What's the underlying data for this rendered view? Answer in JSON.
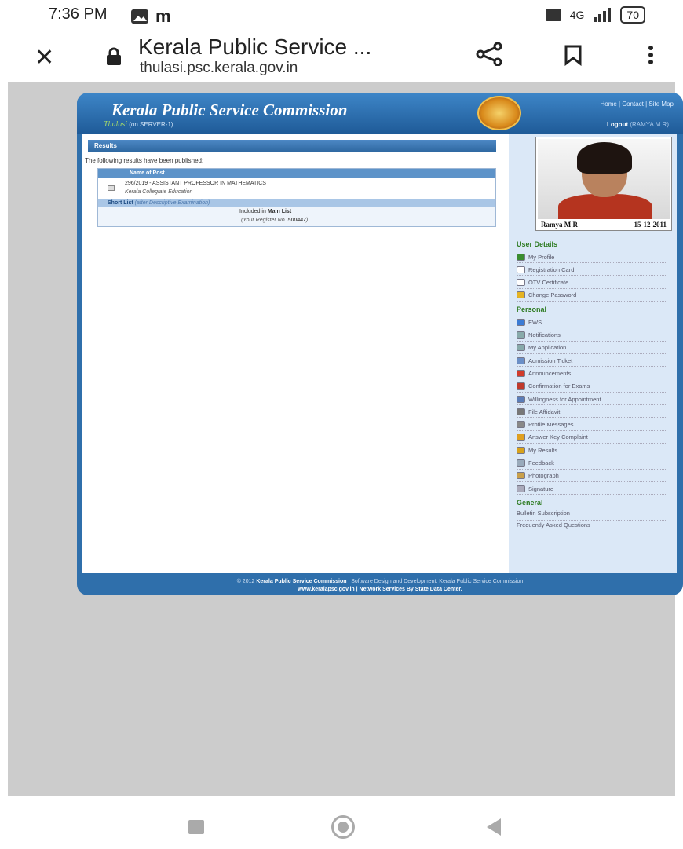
{
  "status_bar": {
    "time": "7:36 PM",
    "app_letter": "m",
    "signal": "4G",
    "battery": "70"
  },
  "chrome": {
    "title": "Kerala Public Service ...",
    "url": "thulasi.psc.kerala.gov.in"
  },
  "site": {
    "title": "Kerala Public Service Commission",
    "thulasi": "Thulasi",
    "server": "(on SERVER-1)",
    "top_links": "Home | Contact | Site Map",
    "logout_label": "Logout",
    "logout_user": "(RAMYA M R)"
  },
  "results": {
    "header": "Results",
    "intro": "The following results have been published:",
    "column": "Name of Post",
    "post": "296/2019 - ASSISTANT PROFESSOR IN MATHEMATICS",
    "department": "Kerala Collegiate Education",
    "shortlist_label": "Short List",
    "shortlist_note": "(after Descriptive Examination)",
    "included_prefix": "Included in",
    "included_list": "Main List",
    "register_prefix": "(Your Register No.",
    "register_no": "500447",
    "register_suffix": ")"
  },
  "profile": {
    "name": "Ramya M R",
    "date": "15-12-2011"
  },
  "sidebar": {
    "user_details_title": "User Details",
    "user_details": [
      "My Profile",
      "Registration Card",
      "OTV Certificate",
      "Change Password"
    ],
    "personal_title": "Personal",
    "personal": [
      "EWS",
      "Notifications",
      "My Application",
      "Admission Ticket",
      "Announcements",
      "Confirmation for Exams",
      "Willingness for Appointment",
      "File Affidavit",
      "Profile Messages",
      "Answer Key Complaint",
      "My Results",
      "Feedback",
      "Photograph",
      "Signature"
    ],
    "general_title": "General",
    "general": [
      "Bulletin Subscription",
      "Frequently Asked Questions"
    ]
  },
  "footer": {
    "line1_prefix": "© 2012",
    "line1_org": "Kerala Public Service Commission",
    "line1_rest": "| Software Design and Development: Kerala Public Service Commission",
    "line2": "www.keralapsc.gov.in | Network Services By State Data Center."
  },
  "icon_colors": [
    "#3a8d2f",
    "#ffffff",
    "#ffffff",
    "#e6b422",
    "#3a7bd5",
    "#8aa",
    "#8aa",
    "#6b8fc7",
    "#d23b2b",
    "#c0392b",
    "#5b7db8",
    "#777",
    "#888",
    "#e0a020",
    "#d8a21b",
    "#9ab",
    "#c9a04a",
    "#aab"
  ]
}
